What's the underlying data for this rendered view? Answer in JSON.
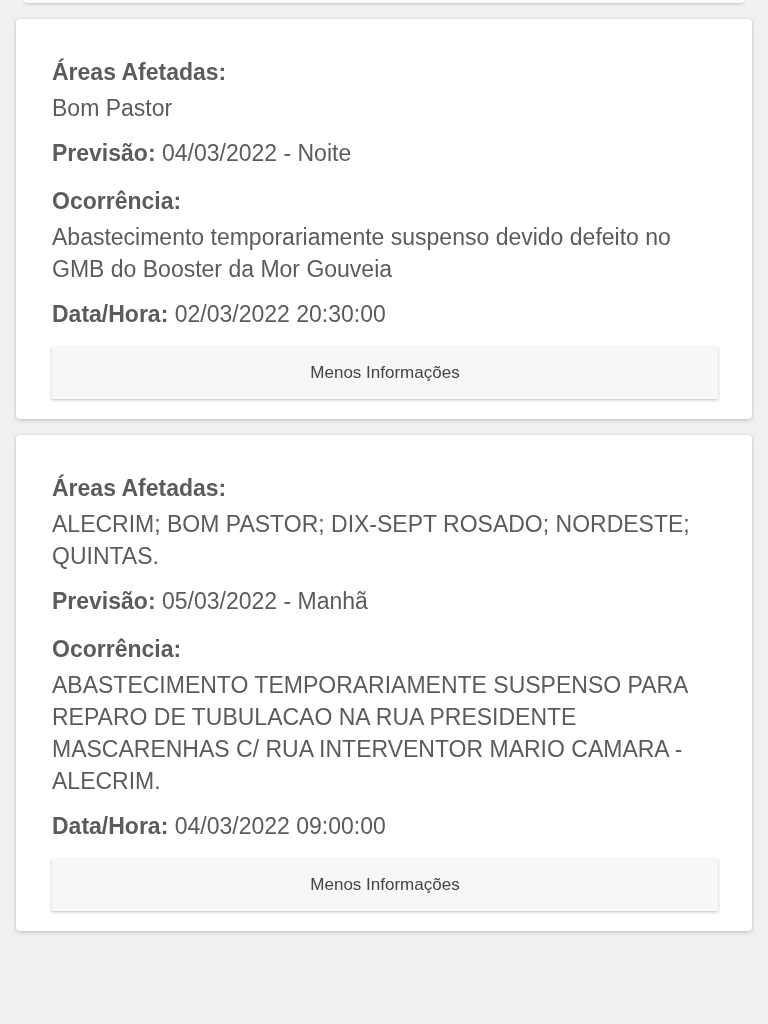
{
  "cards": [
    {
      "fields": [
        {
          "kind": "block",
          "label": "Áreas Afetadas:",
          "value": "Bom Pastor"
        },
        {
          "kind": "inline",
          "label": "Previsão:",
          "value": "04/03/2022 - Noite"
        },
        {
          "kind": "block",
          "label": "Ocorrência:",
          "value": "Abastecimento temporariamente suspenso devido defeito no GMB do Booster da Mor Gouveia"
        },
        {
          "kind": "inline",
          "label": "Data/Hora:",
          "value": "02/03/2022 20:30:00"
        }
      ],
      "button": "Menos Informações"
    },
    {
      "fields": [
        {
          "kind": "block",
          "label": "Áreas Afetadas:",
          "value": "ALECRIM; BOM PASTOR; DIX-SEPT ROSADO; NORDESTE; QUINTAS."
        },
        {
          "kind": "inline",
          "label": "Previsão:",
          "value": "05/03/2022 - Manhã"
        },
        {
          "kind": "block",
          "label": "Ocorrência:",
          "value": "ABASTECIMENTO TEMPORARIAMENTE SUSPENSO PARA REPARO DE TUBULACAO NA RUA PRESIDENTE MASCARENHAS C/ RUA INTERVENTOR MARIO CAMARA - ALECRIM."
        },
        {
          "kind": "inline",
          "label": "Data/Hora:",
          "value": "04/03/2022 09:00:00"
        }
      ],
      "button": "Menos Informações"
    }
  ]
}
